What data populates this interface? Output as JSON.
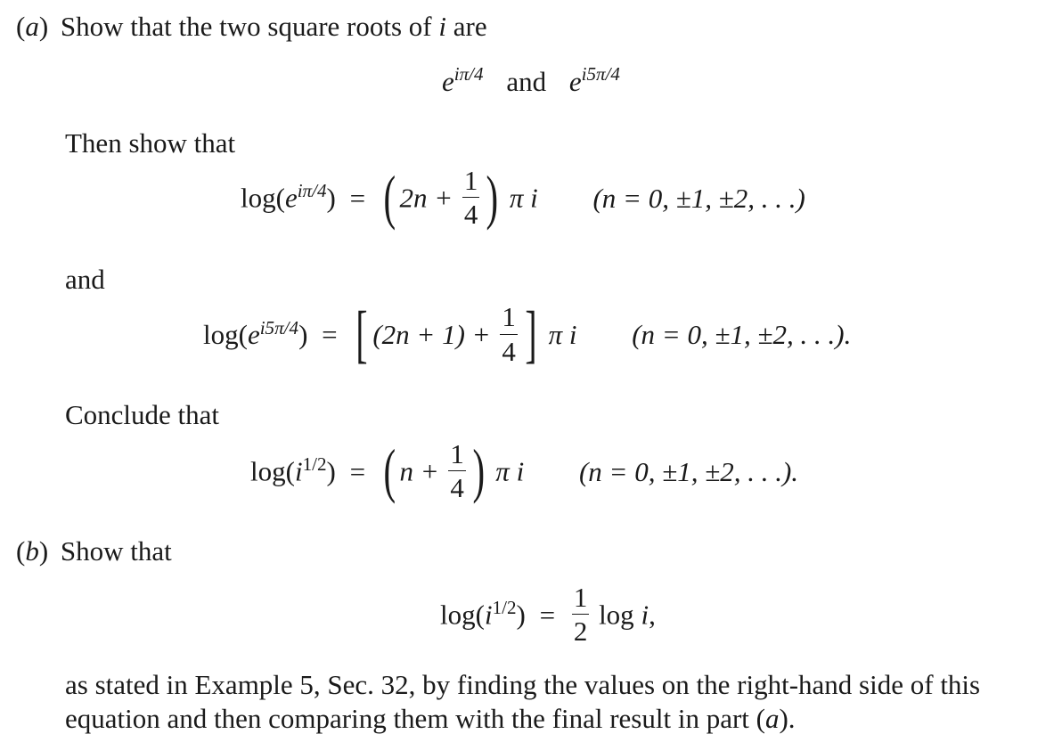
{
  "part_a": {
    "label_open": "(",
    "label_letter": "a",
    "label_close": ")",
    "intro_text": "Show that the two square roots of",
    "intro_var": "i",
    "intro_tail": "are",
    "roots": {
      "base": "e",
      "exp1": "iπ/4",
      "connector": "and",
      "exp2": "i5π/4"
    },
    "then_text": "Then show that",
    "eq1": {
      "lhs_pre": "log(",
      "lhs_base": "e",
      "lhs_exp": "iπ/4",
      "lhs_post": ")",
      "equals": "=",
      "open": "(",
      "inner": "2n +",
      "frac_num": "1",
      "frac_den": "4",
      "close": ")",
      "tail": "π i",
      "condition": "(n = 0, ±1, ±2, . . .)"
    },
    "and_text": "and",
    "eq2": {
      "lhs_pre": "log(",
      "lhs_base": "e",
      "lhs_exp": "i5π/4",
      "lhs_post": ")",
      "equals": "=",
      "open": "[",
      "inner": "(2n + 1) +",
      "frac_num": "1",
      "frac_den": "4",
      "close": "]",
      "tail": "π i",
      "condition": "(n = 0, ±1, ±2, . . .)."
    },
    "conclude_text": "Conclude that",
    "eq3": {
      "lhs_pre": "log(",
      "lhs_base": "i",
      "lhs_exp": "1/2",
      "lhs_post": ")",
      "equals": "=",
      "open": "(",
      "inner": "n +",
      "frac_num": "1",
      "frac_den": "4",
      "close": ")",
      "tail": "π i",
      "condition": "(n = 0, ±1, ±2, . . .)."
    }
  },
  "part_b": {
    "label_open": "(",
    "label_letter": "b",
    "label_close": ")",
    "intro_text": "Show that",
    "eq4": {
      "lhs_pre": "log(",
      "lhs_base": "i",
      "lhs_exp": "1/2",
      "lhs_post": ")",
      "equals": "=",
      "frac_num": "1",
      "frac_den": "2",
      "rhs": "log",
      "rhs_var": "i",
      "rhs_tail": ","
    },
    "closing_line1": "as stated in Example 5, Sec. 32, by finding the values on the right-hand side of this",
    "closing_line2_pre": "equation and then comparing them with the final result in part (",
    "closing_line2_var": "a",
    "closing_line2_post": ")."
  }
}
